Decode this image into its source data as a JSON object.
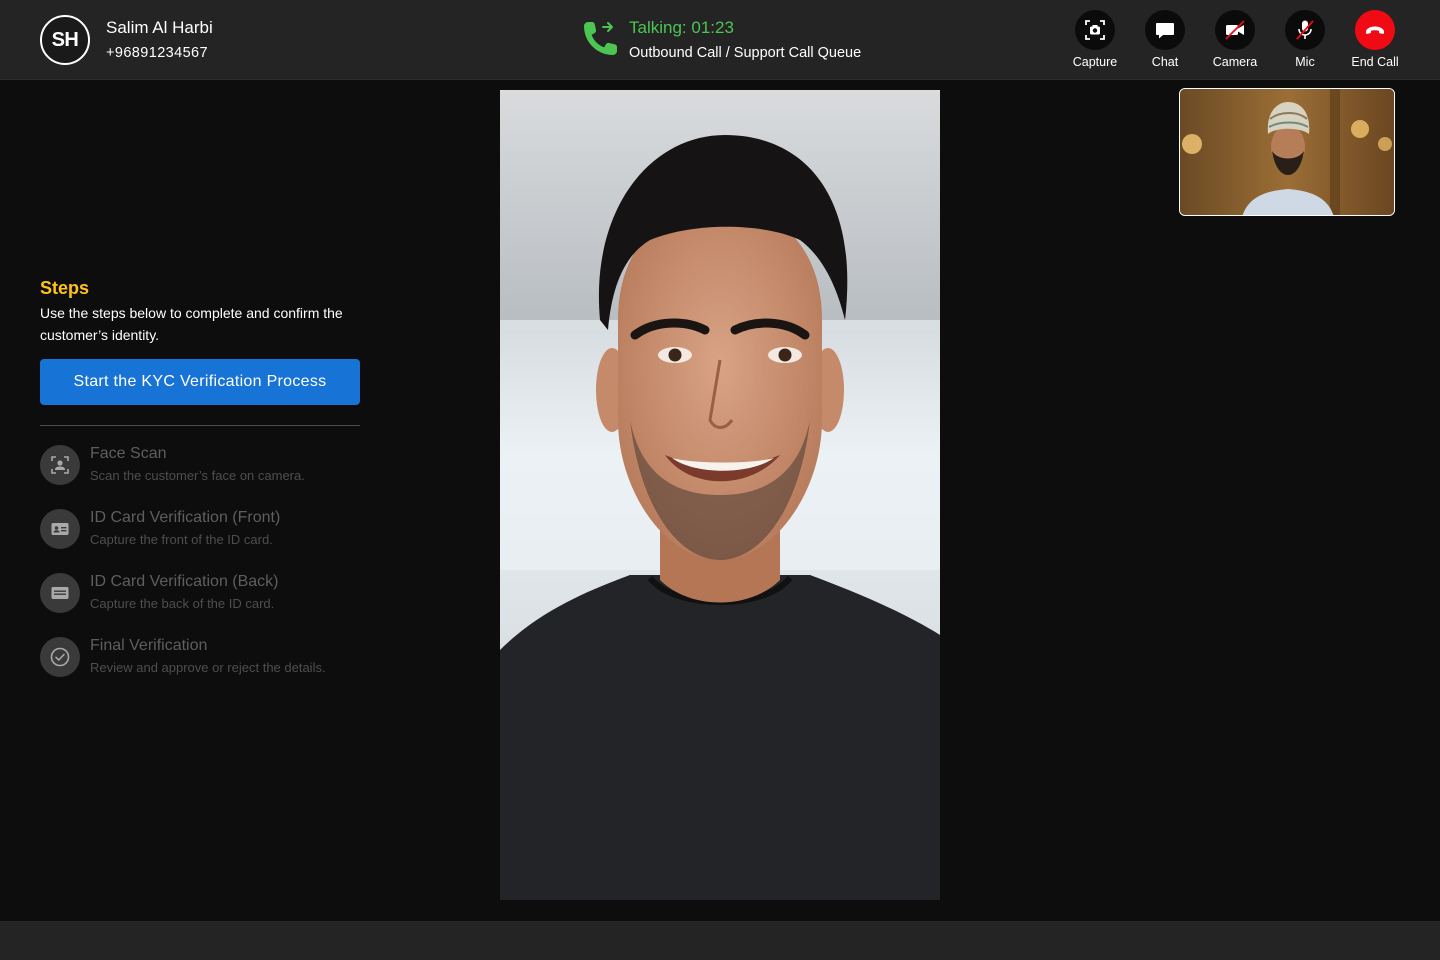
{
  "caller": {
    "initials": "SH",
    "name": "Salim Al Harbi",
    "phone": "+96891234567"
  },
  "call": {
    "status": "Talking: 01:23",
    "queue": "Outbound Call / Support Call Queue"
  },
  "controls": [
    {
      "label": "Capture",
      "icon": "camera-capture-icon"
    },
    {
      "label": "Chat",
      "icon": "chat-bubble-icon"
    },
    {
      "label": "Camera",
      "icon": "video-off-icon"
    },
    {
      "label": "Mic",
      "icon": "mic-off-icon"
    },
    {
      "label": "End Call",
      "icon": "hang-up-icon"
    }
  ],
  "steps": {
    "title": "Steps",
    "description": "Use the steps below to complete and confirm the customer’s identity.",
    "start_button": "Start the KYC Verification Process",
    "items": [
      {
        "title": "Face Scan",
        "subtitle": "Scan the customer’s face on camera.",
        "icon": "face-scan-icon"
      },
      {
        "title": "ID Card Verification (Front)",
        "subtitle": "Capture the front of the ID card.",
        "icon": "id-card-icon"
      },
      {
        "title": "ID Card Verification (Back)",
        "subtitle": "Capture the back of the ID card.",
        "icon": "card-back-icon"
      },
      {
        "title": "Final Verification",
        "subtitle": "Review and approve or reject the details.",
        "icon": "check-circle-icon"
      }
    ]
  },
  "colors": {
    "accent_blue": "#1873d7",
    "steps_title": "#ffc21a",
    "talking_green": "#4cc552",
    "end_call_red": "#f00b14",
    "header_bg": "#242424",
    "page_bg": "#0d0d0e"
  }
}
